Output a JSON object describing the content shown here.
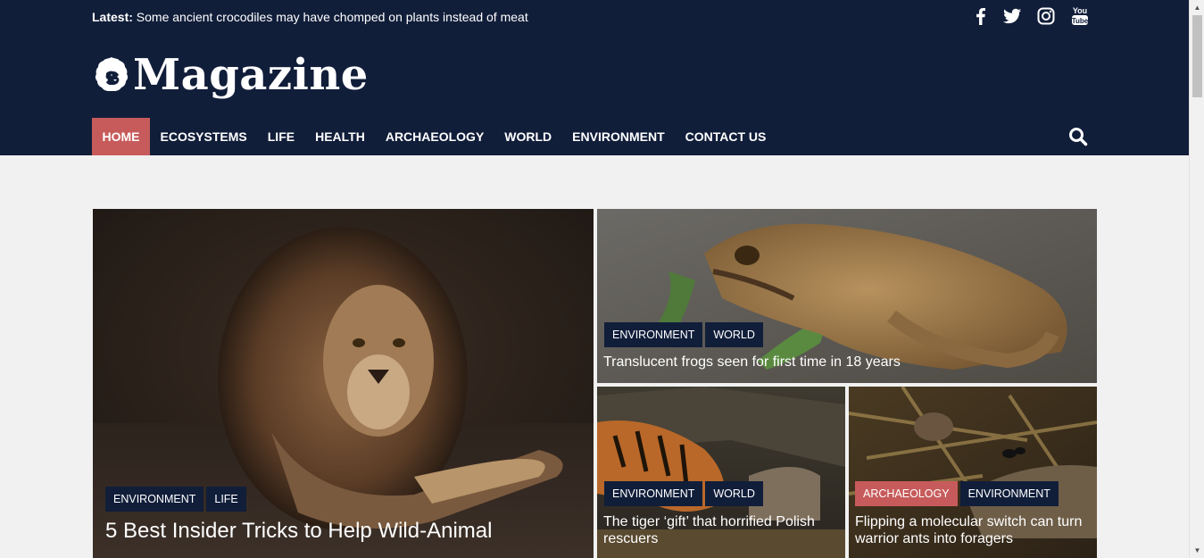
{
  "topbar": {
    "latest_label": "Latest:",
    "latest_text": "Some ancient crocodiles may have chomped on plants instead of meat"
  },
  "social": [
    "facebook-icon",
    "twitter-icon",
    "instagram-icon",
    "youtube-icon"
  ],
  "logo": {
    "text": "Magazine"
  },
  "nav": {
    "items": [
      "HOME",
      "ECOSYSTEMS",
      "LIFE",
      "HEALTH",
      "ARCHAEOLOGY",
      "WORLD",
      "ENVIRONMENT",
      "CONTACT US"
    ],
    "active": "HOME"
  },
  "colors": {
    "header_bg": "#111e3a",
    "accent": "#c75b5b",
    "page_bg": "#f1f1f1"
  },
  "featured": [
    {
      "title": "5 Best Insider Tricks to Help Wild-Animal",
      "tags": [
        "ENVIRONMENT",
        "LIFE"
      ]
    },
    {
      "title": "Translucent frogs seen for first time in 18 years",
      "tags": [
        "ENVIRONMENT",
        "WORLD"
      ]
    },
    {
      "title": "The tiger ‘gift’ that horrified Polish rescuers",
      "tags": [
        "ENVIRONMENT",
        "WORLD"
      ]
    },
    {
      "title": "Flipping a molecular switch can turn warrior ants into foragers",
      "tags": [
        "ARCHAEOLOGY",
        "ENVIRONMENT"
      ]
    }
  ]
}
